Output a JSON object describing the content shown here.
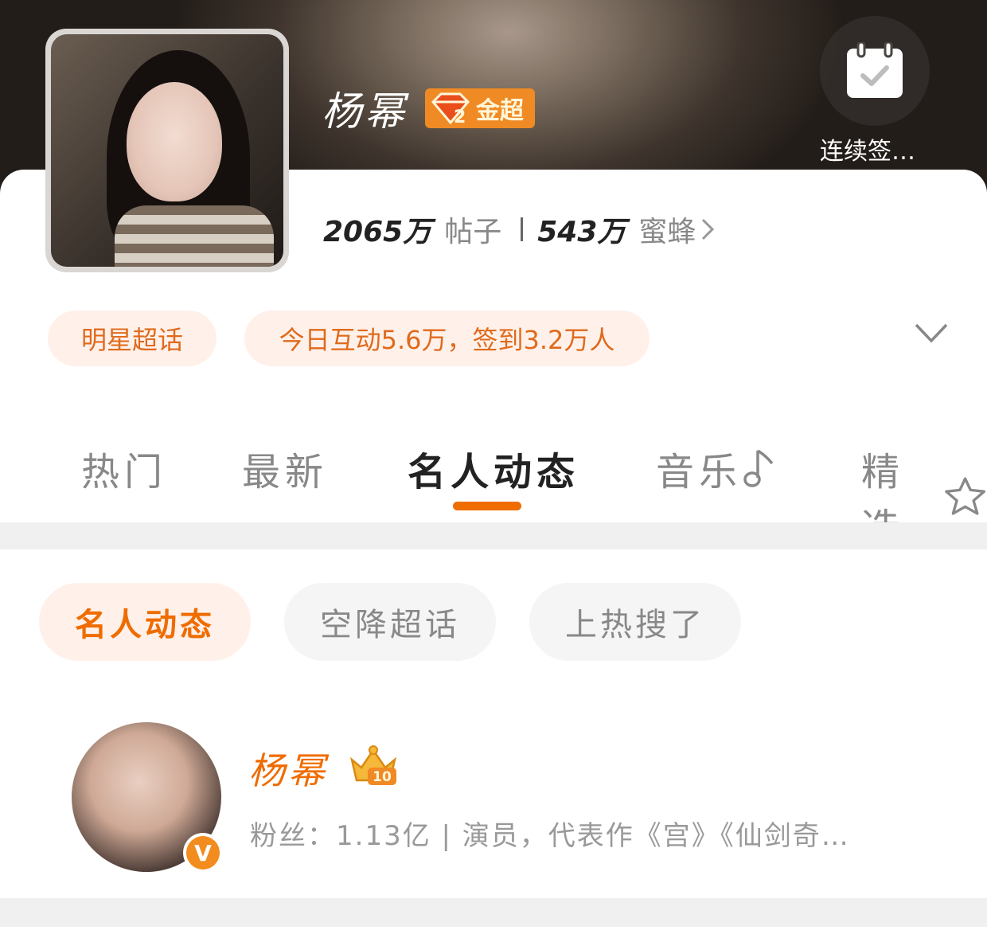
{
  "header": {
    "title": "杨幂",
    "badge_label": "金超",
    "badge_level": "2",
    "checkin_label": "连续签…"
  },
  "stats": {
    "posts_value": "2065万",
    "posts_label": "帖子",
    "fans_value": "543万",
    "fans_label": "蜜蜂"
  },
  "pills": {
    "category": "明星超话",
    "activity": "今日互动5.6万，签到3.2万人"
  },
  "tabs": [
    {
      "label": "热门"
    },
    {
      "label": "最新"
    },
    {
      "label": "名人动态"
    },
    {
      "label": "音乐"
    },
    {
      "label": "精选"
    }
  ],
  "active_tab": "名人动态",
  "chips": [
    {
      "label": "名人动态"
    },
    {
      "label": "空降超话"
    },
    {
      "label": "上热搜了"
    }
  ],
  "post": {
    "author": "杨幂",
    "crown_level": "10",
    "verified_mark": "V",
    "description": "粉丝：1.13亿 | 演员，代表作《宫》《仙剑奇…"
  },
  "colors": {
    "accent": "#ef6c00",
    "pill_bg": "#fff1ea",
    "divider": "#f0f0f0"
  },
  "icons": [
    "calendar-check-icon",
    "chevron-down-icon",
    "chevron-right-icon",
    "music-note-icon",
    "star-icon",
    "diamond-icon",
    "crown-icon",
    "verified-icon"
  ]
}
